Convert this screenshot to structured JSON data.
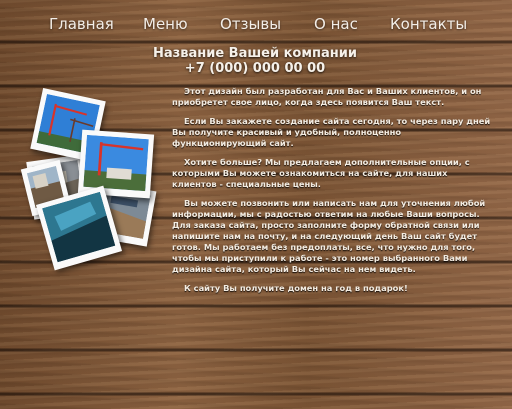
{
  "nav": {
    "home": "Главная",
    "menu": "Меню",
    "reviews": "Отзывы",
    "about": "О нас",
    "contacts": "Контакты"
  },
  "header": {
    "company_name": "Название Вашей компании",
    "phone": "+7 (000) 000 00 00"
  },
  "content": {
    "p1": "Этот дизайн был разработан для Вас и Ваших клиентов, и он приобретет свое лицо, когда здесь появится Ваш текст.",
    "p2": "Если Вы закажете создание сайта сегодня, то через пару дней Вы получите красивый и удобный, полноценно функционирующий сайт.",
    "p3": "Хотите больше? Мы предлагаем дополнительные опции, с которыми Вы можете ознакомиться на сайте, для наших клиентов - специальные цены.",
    "p4": "Вы можете позвонить или написать нам для уточнения любой информации, мы с радостью ответим на любые Ваши вопросы. Для заказа сайта, просто заполните форму обратной связи или напишите нам на почту, и на следующий день Ваш сайт будет готов. Мы работаем без предоплаты, все, что нужно для того, чтобы мы приступили к работе - это номер выбранного Вами дизайна сайта, который Вы сейчас на нем видеть.",
    "p5": "К сайту Вы получите домен на год в подарок!"
  },
  "photos": {
    "sky_color": "#2f7fd6",
    "crane_color": "#d8332a"
  }
}
